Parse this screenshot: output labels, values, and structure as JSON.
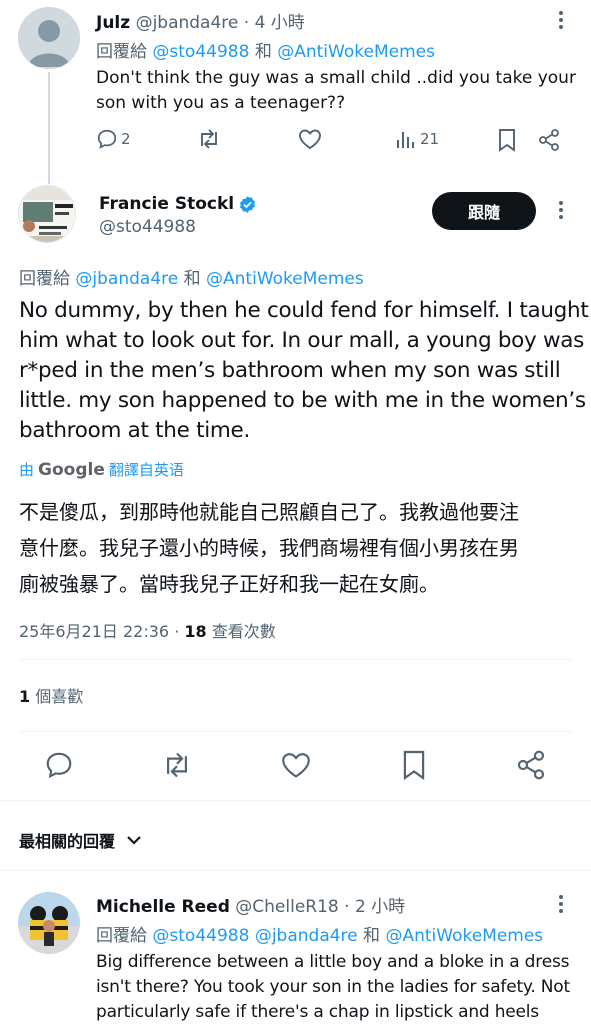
{
  "reply1": {
    "name": "Julz",
    "handle": "@jbanda4re",
    "time": "· 4 小時",
    "reply_prefix": "回覆給",
    "reply_to_1": "@sto44988",
    "reply_and": "和",
    "reply_to_2": "@AntiWokeMemes",
    "text_line1": "Don't think the guy was a  small child ..did you take your",
    "text_line2": "son with you as a teenager??",
    "reply_count": "2",
    "view_count": "21"
  },
  "main_tweet": {
    "name": "Francie Stockl",
    "handle": "@sto44988",
    "follow_label": "跟隨",
    "reply_prefix": "回覆給",
    "reply_to_1": "@jbanda4re",
    "reply_and": "和",
    "reply_to_2": "@AntiWokeMemes",
    "text_lines": [
      "No dummy, by then he could fend for himself. I taught",
      "him what to look out for. In our mall, a young boy was",
      "r*ped in the men’s bathroom when my son was still",
      "little. my son happened to be with me in the women’s",
      "bathroom at the time."
    ],
    "translate_prefix": "由",
    "translate_brand": "Google",
    "translate_suffix": "翻譯自英语",
    "translated_lines": [
      "不是傻瓜，到那時他就能自己照顧自己了。我教過他要注",
      "意什麼。我兒子還小的時候，我們商場裡有個小男孩在男",
      "廁被強暴了。當時我兒子正好和我一起在女廁。"
    ],
    "timestamp": "25年6月21日 22:36",
    "views_sep": "·",
    "views_count": "18",
    "views_label": "查看次數",
    "likes_count": "1",
    "likes_label": "個喜歡"
  },
  "sort": {
    "label": "最相關的回覆"
  },
  "reply2": {
    "name": "Michelle Reed",
    "handle": "@ChelleR18",
    "time": "· 2 小時",
    "reply_prefix": "回覆給",
    "reply_to_1": "@sto44988",
    "reply_to_2": "@jbanda4re",
    "reply_and": "和",
    "reply_to_3": "@AntiWokeMemes",
    "text_lines": [
      "Big difference between a little boy and a bloke in a dress",
      "isn't there? You took your son in the ladies for safety. Not",
      "particularly safe if there's a chap in lipstick and heels"
    ]
  },
  "colors": {
    "link": "#1d9bf0",
    "muted": "#536471",
    "verified": "#1d9bf0",
    "follow_bg": "#0f1419"
  }
}
